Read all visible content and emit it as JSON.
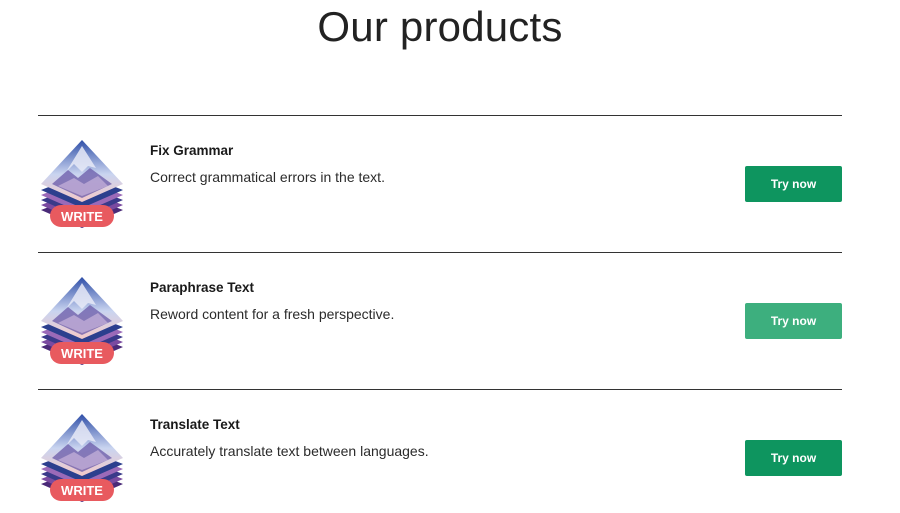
{
  "page": {
    "title": "Our products"
  },
  "products": [
    {
      "name": "Fix Grammar",
      "description": "Correct grammatical errors in the text.",
      "badge": "WRITE",
      "button_label": "Try now",
      "icon": "write-app-icon"
    },
    {
      "name": "Paraphrase Text",
      "description": "Reword content for a fresh perspective.",
      "badge": "WRITE",
      "button_label": "Try now",
      "icon": "write-app-icon"
    },
    {
      "name": "Translate Text",
      "description": "Accurately translate text between languages.",
      "badge": "WRITE",
      "button_label": "Try now",
      "icon": "write-app-icon"
    }
  ],
  "colors": {
    "button_green": "#0e955f",
    "button_green_hover": "#3daf7e",
    "badge_red": "#e85a5f",
    "divider": "#333333"
  }
}
